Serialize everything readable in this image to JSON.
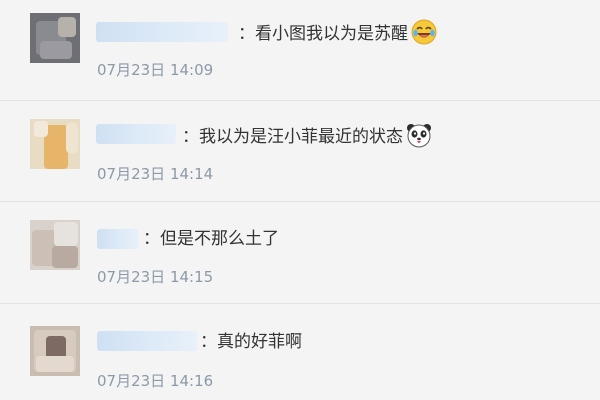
{
  "comments": [
    {
      "separator": "：",
      "text": "看小图我以为是苏醒",
      "emoji": "laughing-crying-emoji-icon",
      "timestamp": "07月23日 14:09"
    },
    {
      "separator": "：",
      "text": "我以为是汪小菲最近的状态",
      "emoji": "panda-face-emoji-icon",
      "timestamp": "07月23日 14:14"
    },
    {
      "separator": "：",
      "text": "但是不那么土了",
      "timestamp": "07月23日 14:15"
    },
    {
      "separator": "：",
      "text": "真的好菲啊",
      "timestamp": "07月23日 14:16"
    }
  ],
  "colors": {
    "background": "#f4f4f4",
    "text": "#333333",
    "timestamp": "#8c9aa8",
    "username_blur": "#cfe0f3"
  }
}
